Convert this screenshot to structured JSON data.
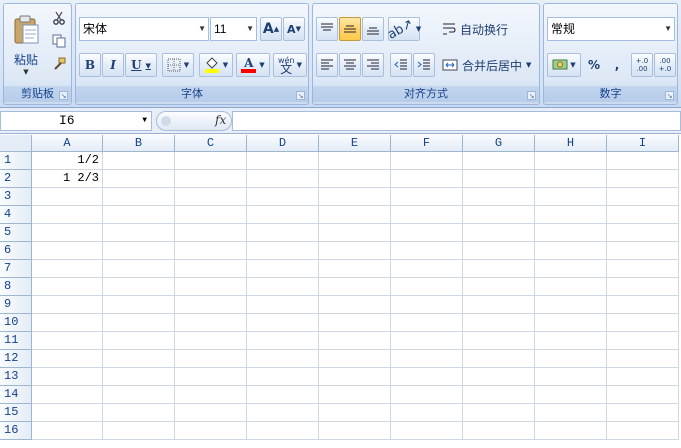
{
  "clipboard": {
    "paste_label": "粘贴",
    "group_label": "剪贴板"
  },
  "font": {
    "name": "宋体",
    "size": "11",
    "group_label": "字体",
    "grow_label": "A",
    "shrink_label": "A",
    "bold": "B",
    "italic": "I",
    "underline": "U",
    "color_label": "A",
    "phonetic_label": "wén"
  },
  "alignment": {
    "wrap_label": "自动换行",
    "merge_label": "合并后居中",
    "group_label": "对齐方式"
  },
  "number": {
    "format": "常规",
    "group_label": "数字",
    "percent": "%",
    "comma": ",",
    "inc_decimal": "+.0 .00",
    "dec_decimal": ".00 +.0"
  },
  "formula_bar": {
    "name_box": "I6",
    "fx": "fx",
    "value": ""
  },
  "columns": [
    "A",
    "B",
    "C",
    "D",
    "E",
    "F",
    "G",
    "H",
    "I"
  ],
  "rows": [
    "1",
    "2",
    "3",
    "4",
    "5",
    "6",
    "7",
    "8",
    "9",
    "10",
    "11",
    "12",
    "13",
    "14",
    "15",
    "16"
  ],
  "cells": {
    "A1": "1/2",
    "A2": "1 2/3"
  },
  "colors": {
    "ribbon": "#d7e4f4",
    "highlight": "#ffd36b",
    "font_color": "#ff0000"
  }
}
